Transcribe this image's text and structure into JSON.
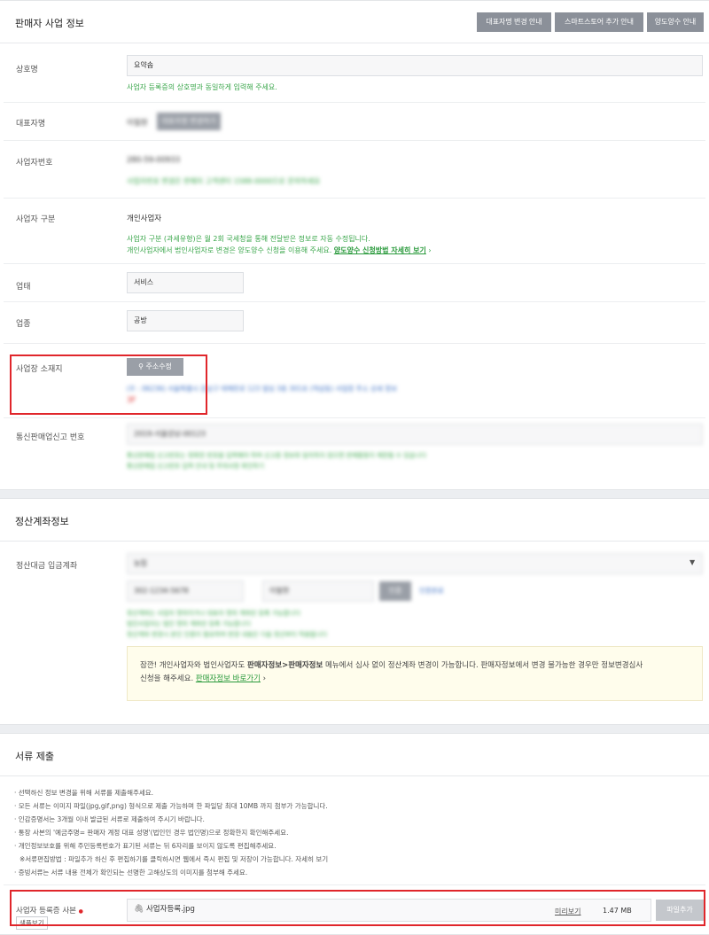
{
  "seller": {
    "title": "판매자 사업 정보",
    "buttons": [
      "대표자명 변경 안내",
      "스마트스토어 추가 안내",
      "양도양수 안내"
    ],
    "company_label": "상호명",
    "company_value": "요약솝",
    "company_hint": "사업자 등록증의 상호명과 동일하게 입력해 주세요.",
    "ceo_label": "대표자명",
    "ceo_value": "이필현",
    "ceo_button": "대표자명 변경하기",
    "bizno_label": "사업자번호",
    "bizno_value": "280-59-00933",
    "bizno_hint": "사업자번호 변경은 판매자 고객센터 1588-0000으로 문의하세요",
    "biztype_label": "사업자 구분",
    "biztype_value": "개인사업자",
    "biztype_hint1": "사업자 구분 (과세유형)은 월 2회 국세청을 통해 전달받은 정보로 자동 수정됩니다.",
    "biztype_hint2": "개인사업자에서 법인사업자로 변경은 양도양수 신청을 이용해 주세요.",
    "biztype_link": "양도양수 신청방법 자세히 보기",
    "biztype_link_arrow": "›",
    "category_label": "업태",
    "category_value": "서비스",
    "item_label": "업종",
    "item_value": "공방",
    "address_label": "사업장 소재지",
    "address_button": "주소수정",
    "address_value": "(우 : 06236) 서울특별시 강남구 테헤란로 123 빌딩 3층 301호 (역삼동) 사업장 주소 상세 정보",
    "address_note": "3F",
    "mailorder_label": "통신판매업신고 번호",
    "mailorder_value": "2019-서울강남-00123",
    "mailorder_hint1": "통신판매업 신고번호는 정확한 번호를 입력해야 하며 신고증 정보와 일치하지 않으면 판매활동이 제한될 수 있습니다",
    "mailorder_hint2": "통신판매업 신고번호 입력 안내 및 주의사항 확인하기",
    "mailorder_link": "통신판매업 신고방법 자세히"
  },
  "settlement": {
    "title": "정산계좌정보",
    "account_label": "정산대금 입금계좌",
    "bank_select": "농협",
    "account_no": "302-1234-5678",
    "holder": "이필현",
    "verify_button": "인증",
    "verify_status": "인증완료",
    "hint1": "정산계좌는 사업자 명의이거나 대표자 명의 계좌만 등록 가능합니다",
    "hint2": "법인사업자는 법인 명의 계좌만 등록 가능합니다",
    "hint3": "정산계좌 변경시 본인 인증이 필요하며 변경 내용은 다음 정산부터 적용됩니다",
    "notice_prefix": "잠깐! 개인사업자와 법인사업자도 ",
    "notice_bold": "판매자정보>판매자정보",
    "notice_mid": " 메뉴에서 심사 없이 정산계좌 변경이 가능합니다. 판매자정보에서 변경 불가능한 경우만 정보변경심사",
    "notice_line2": "신청을 해주세요. ",
    "notice_link": "판매자정보 바로가기",
    "notice_arrow": "›"
  },
  "documents": {
    "title": "서류 제출",
    "lines": [
      "· 선택하신 정보 변경을 위해 서류를 제출해주세요.",
      "· 모든 서류는 이미지 파일(jpg,gif,png) 형식으로 제출 가능하며 한 파일당 최대 10MB 까지 첨부가 가능합니다.",
      "· 인감증명서는 3개월 이내 발급된 서류로 제출하여 주시기 바랍니다.",
      "· 통장 사본의 '예금주명= 판매자 계정 대표 성명'(법인인 경우 법인명)으로 정확한지 확인해주세요.",
      "· 개인정보보호를 위해 주민등록번호가 표기된 서류는 뒤 6자리를 보이지 않도록 편집해주세요.",
      "※서류편집방법 : 파일추가 하신 후 편집하기를 클릭하시면 웹에서 즉시 편집 및 저장이 가능합니다. 자세히 보기",
      "· 증빙서류는 서류 내용 전체가 확인되는 선명한 고해상도의 이미지를 첨부해 주세요."
    ],
    "file_row_label": "사업자 등록증 사본",
    "required_mark": "●",
    "sample_button": "샘플보기",
    "file_name": "사업자등록.jpg",
    "preview_link": "미리보기",
    "file_size": "1.47 MB",
    "add_button": "파일추가"
  },
  "colors": {
    "accent_green": "#39a64a",
    "highlight_red": "#e0262b",
    "button_gray": "#8b9099"
  }
}
